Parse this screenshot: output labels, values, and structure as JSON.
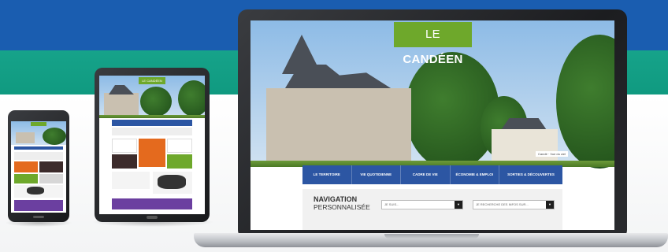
{
  "site": {
    "logo_prefix": "LE",
    "logo_name": "CANDÉEN"
  },
  "hero": {
    "caption": "Candé · Vue du ciel"
  },
  "navigation": {
    "items": [
      "LE TERRITOIRE",
      "VIE QUOTIDIENNE",
      "CADRE DE VIE",
      "ÉCONOMIE & EMPLOI",
      "SORTIES & DÉCOUVERTES"
    ]
  },
  "personalized_nav": {
    "title_line1": "NAVIGATION",
    "title_line2": "PERSONNALISÉE",
    "select1_text": "JE SUIS...",
    "select2_text": "JE RECHERCHE DES INFOS SUR...",
    "dropdown_arrow": "▼"
  },
  "colors": {
    "brand_green": "#6ea82b",
    "nav_blue": "#2c56a3",
    "band_blue": "#1a5db0",
    "band_green": "#16a38a"
  }
}
